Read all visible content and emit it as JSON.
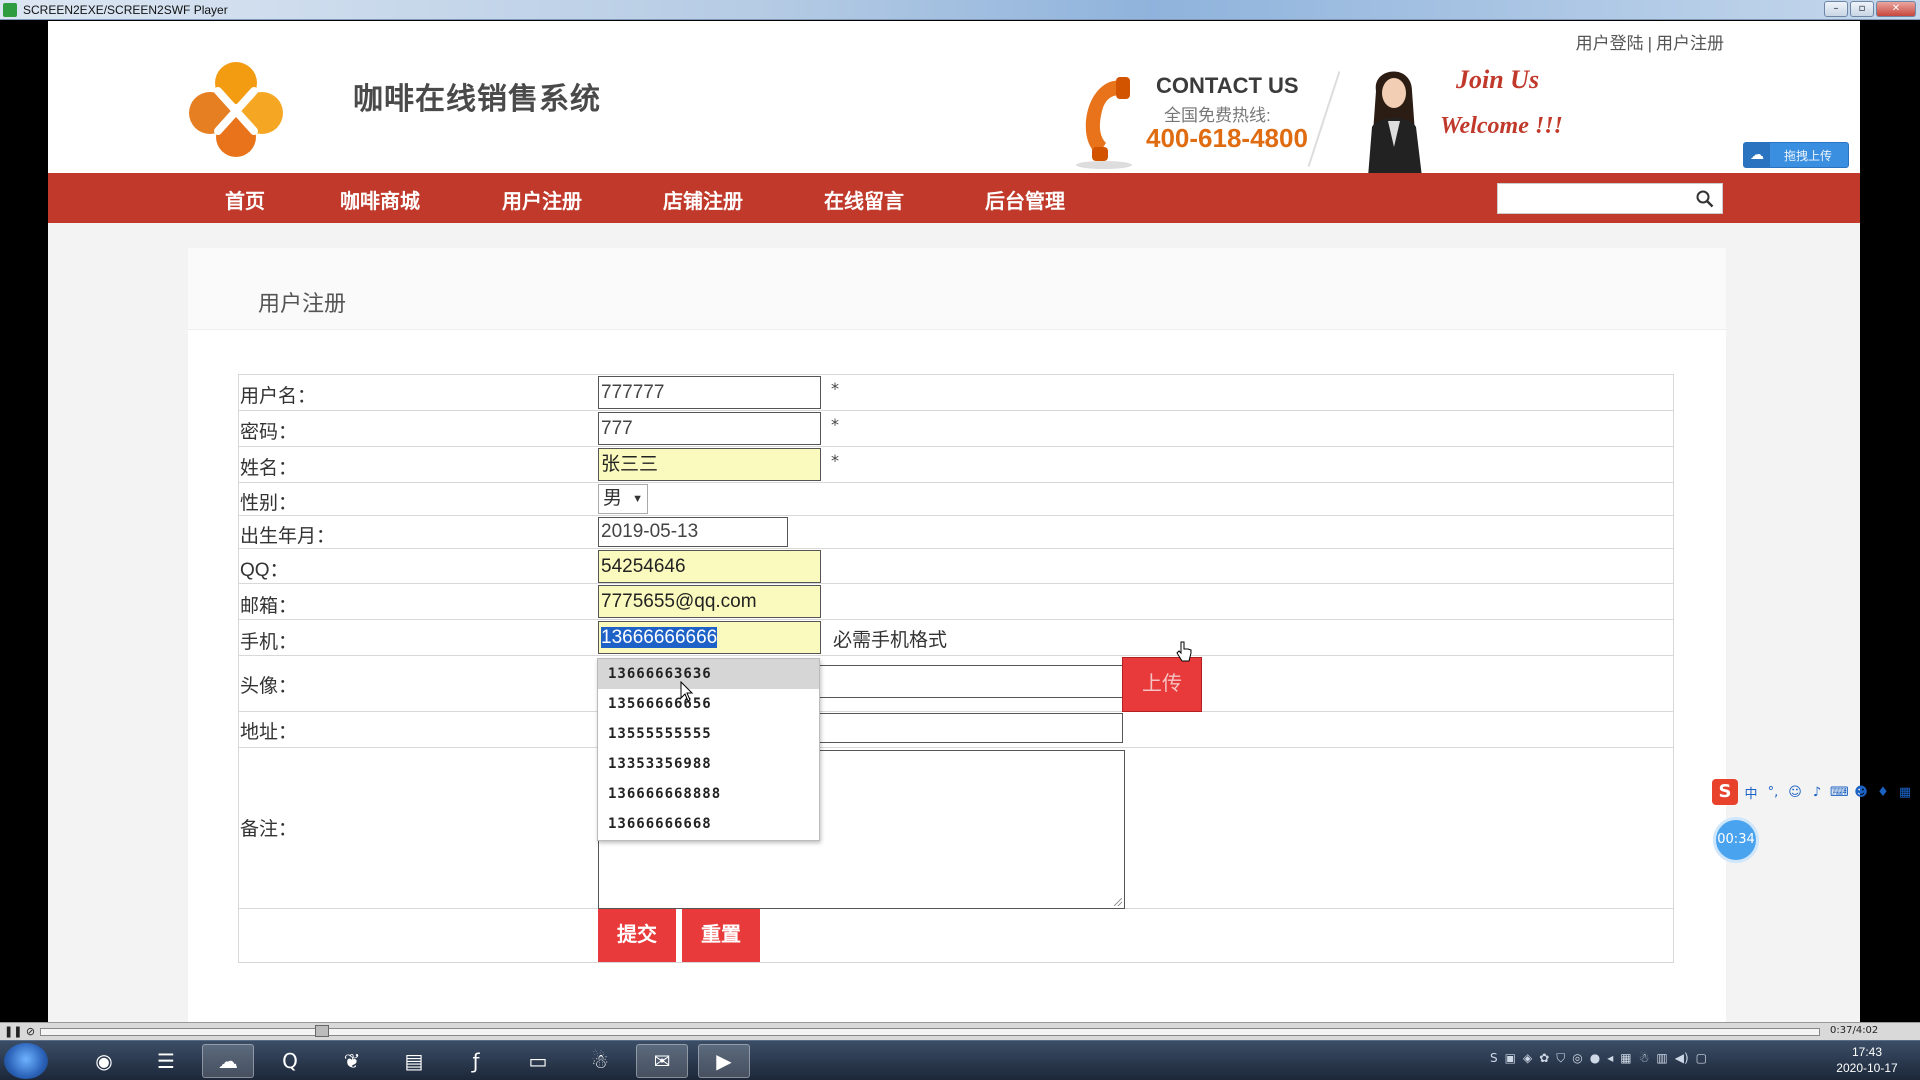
{
  "player": {
    "title": "SCREEN2EXE/SCREEN2SWF Player",
    "time": "0:37/4:02"
  },
  "header": {
    "site_title": "咖啡在线销售系统",
    "top_links": [
      "用户登陆",
      "用户注册"
    ],
    "top_links_sep": "|",
    "contact_title": "CONTACT US",
    "contact_sub": "全国免费热线:",
    "contact_phone": "400-618-4800",
    "join": "Join Us",
    "welcome": "Welcome !!!",
    "upload_widget": "拖拽上传"
  },
  "nav": {
    "items": [
      "首页",
      "咖啡商城",
      "用户注册",
      "店铺注册",
      "在线留言",
      "后台管理"
    ]
  },
  "search": {
    "placeholder": ""
  },
  "card": {
    "title": "用户注册"
  },
  "form": {
    "username_label": "用户名：",
    "username": "777777",
    "password_label": "密码：",
    "password": "777",
    "name_label": "姓名：",
    "name": "张三三",
    "gender_label": "性别：",
    "gender": "男",
    "birth_label": "出生年月：",
    "birth": "2019-05-13",
    "qq_label": "QQ：",
    "qq": "54254646",
    "email_label": "邮箱：",
    "email": "7775655@qq.com",
    "phone_label": "手机：",
    "phone": "13666666666",
    "phone_hint": "必需手机格式",
    "avatar_label": "头像：",
    "avatar": "",
    "upload_button": "上传",
    "address_label": "地址：",
    "address": "",
    "remark_label": "备注：",
    "required_mark": "*",
    "submit": "提交",
    "reset": "重置"
  },
  "autocomplete": [
    "13666663636",
    "13566666656",
    "13555555555",
    "13353356988",
    "136666668888",
    "13666666668"
  ],
  "ime": {
    "logo": "S",
    "lang": "中"
  },
  "timer": "00:34",
  "clock": {
    "time": "17:43",
    "date": "2020-10-17"
  }
}
